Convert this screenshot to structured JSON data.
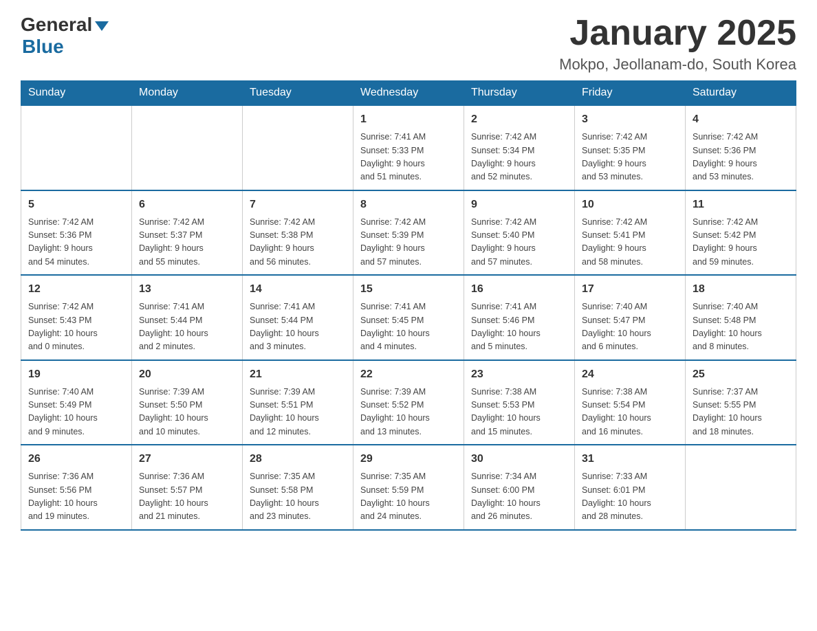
{
  "header": {
    "logo_general": "General",
    "logo_blue": "Blue",
    "month_title": "January 2025",
    "location": "Mokpo, Jeollanam-do, South Korea"
  },
  "days_of_week": [
    "Sunday",
    "Monday",
    "Tuesday",
    "Wednesday",
    "Thursday",
    "Friday",
    "Saturday"
  ],
  "weeks": [
    [
      {
        "day": "",
        "info": ""
      },
      {
        "day": "",
        "info": ""
      },
      {
        "day": "",
        "info": ""
      },
      {
        "day": "1",
        "info": "Sunrise: 7:41 AM\nSunset: 5:33 PM\nDaylight: 9 hours\nand 51 minutes."
      },
      {
        "day": "2",
        "info": "Sunrise: 7:42 AM\nSunset: 5:34 PM\nDaylight: 9 hours\nand 52 minutes."
      },
      {
        "day": "3",
        "info": "Sunrise: 7:42 AM\nSunset: 5:35 PM\nDaylight: 9 hours\nand 53 minutes."
      },
      {
        "day": "4",
        "info": "Sunrise: 7:42 AM\nSunset: 5:36 PM\nDaylight: 9 hours\nand 53 minutes."
      }
    ],
    [
      {
        "day": "5",
        "info": "Sunrise: 7:42 AM\nSunset: 5:36 PM\nDaylight: 9 hours\nand 54 minutes."
      },
      {
        "day": "6",
        "info": "Sunrise: 7:42 AM\nSunset: 5:37 PM\nDaylight: 9 hours\nand 55 minutes."
      },
      {
        "day": "7",
        "info": "Sunrise: 7:42 AM\nSunset: 5:38 PM\nDaylight: 9 hours\nand 56 minutes."
      },
      {
        "day": "8",
        "info": "Sunrise: 7:42 AM\nSunset: 5:39 PM\nDaylight: 9 hours\nand 57 minutes."
      },
      {
        "day": "9",
        "info": "Sunrise: 7:42 AM\nSunset: 5:40 PM\nDaylight: 9 hours\nand 57 minutes."
      },
      {
        "day": "10",
        "info": "Sunrise: 7:42 AM\nSunset: 5:41 PM\nDaylight: 9 hours\nand 58 minutes."
      },
      {
        "day": "11",
        "info": "Sunrise: 7:42 AM\nSunset: 5:42 PM\nDaylight: 9 hours\nand 59 minutes."
      }
    ],
    [
      {
        "day": "12",
        "info": "Sunrise: 7:42 AM\nSunset: 5:43 PM\nDaylight: 10 hours\nand 0 minutes."
      },
      {
        "day": "13",
        "info": "Sunrise: 7:41 AM\nSunset: 5:44 PM\nDaylight: 10 hours\nand 2 minutes."
      },
      {
        "day": "14",
        "info": "Sunrise: 7:41 AM\nSunset: 5:44 PM\nDaylight: 10 hours\nand 3 minutes."
      },
      {
        "day": "15",
        "info": "Sunrise: 7:41 AM\nSunset: 5:45 PM\nDaylight: 10 hours\nand 4 minutes."
      },
      {
        "day": "16",
        "info": "Sunrise: 7:41 AM\nSunset: 5:46 PM\nDaylight: 10 hours\nand 5 minutes."
      },
      {
        "day": "17",
        "info": "Sunrise: 7:40 AM\nSunset: 5:47 PM\nDaylight: 10 hours\nand 6 minutes."
      },
      {
        "day": "18",
        "info": "Sunrise: 7:40 AM\nSunset: 5:48 PM\nDaylight: 10 hours\nand 8 minutes."
      }
    ],
    [
      {
        "day": "19",
        "info": "Sunrise: 7:40 AM\nSunset: 5:49 PM\nDaylight: 10 hours\nand 9 minutes."
      },
      {
        "day": "20",
        "info": "Sunrise: 7:39 AM\nSunset: 5:50 PM\nDaylight: 10 hours\nand 10 minutes."
      },
      {
        "day": "21",
        "info": "Sunrise: 7:39 AM\nSunset: 5:51 PM\nDaylight: 10 hours\nand 12 minutes."
      },
      {
        "day": "22",
        "info": "Sunrise: 7:39 AM\nSunset: 5:52 PM\nDaylight: 10 hours\nand 13 minutes."
      },
      {
        "day": "23",
        "info": "Sunrise: 7:38 AM\nSunset: 5:53 PM\nDaylight: 10 hours\nand 15 minutes."
      },
      {
        "day": "24",
        "info": "Sunrise: 7:38 AM\nSunset: 5:54 PM\nDaylight: 10 hours\nand 16 minutes."
      },
      {
        "day": "25",
        "info": "Sunrise: 7:37 AM\nSunset: 5:55 PM\nDaylight: 10 hours\nand 18 minutes."
      }
    ],
    [
      {
        "day": "26",
        "info": "Sunrise: 7:36 AM\nSunset: 5:56 PM\nDaylight: 10 hours\nand 19 minutes."
      },
      {
        "day": "27",
        "info": "Sunrise: 7:36 AM\nSunset: 5:57 PM\nDaylight: 10 hours\nand 21 minutes."
      },
      {
        "day": "28",
        "info": "Sunrise: 7:35 AM\nSunset: 5:58 PM\nDaylight: 10 hours\nand 23 minutes."
      },
      {
        "day": "29",
        "info": "Sunrise: 7:35 AM\nSunset: 5:59 PM\nDaylight: 10 hours\nand 24 minutes."
      },
      {
        "day": "30",
        "info": "Sunrise: 7:34 AM\nSunset: 6:00 PM\nDaylight: 10 hours\nand 26 minutes."
      },
      {
        "day": "31",
        "info": "Sunrise: 7:33 AM\nSunset: 6:01 PM\nDaylight: 10 hours\nand 28 minutes."
      },
      {
        "day": "",
        "info": ""
      }
    ]
  ]
}
